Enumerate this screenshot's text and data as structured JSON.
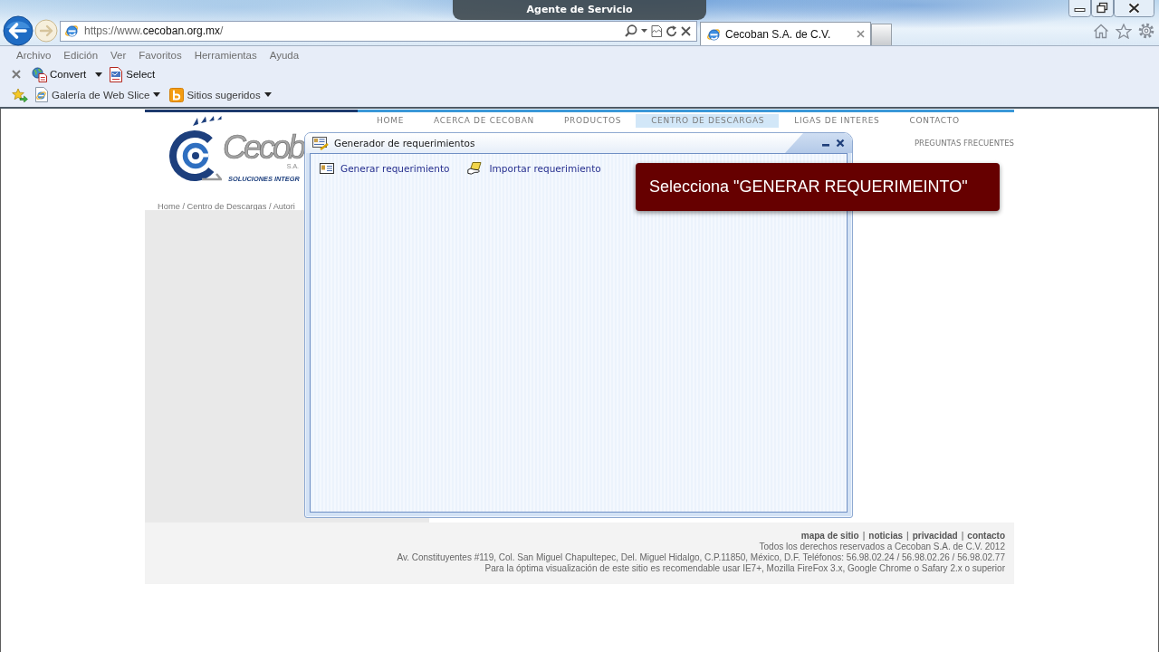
{
  "browser": {
    "notification": "Agente de Servicio",
    "address": {
      "value": "https://www.**cecoban.org.mx**/"
    },
    "tabs": [
      {
        "label": "Cecoban S.A. de C.V.",
        "selected": true
      }
    ],
    "menu": [
      "Archivo",
      "Edición",
      "Ver",
      "Favoritos",
      "Herramientas",
      "Ayuda"
    ],
    "command_bar": [
      {
        "label": "Convert",
        "dropdown": true
      },
      {
        "label": "Select",
        "dropdown": false
      }
    ],
    "favorites_bar": [
      {
        "label": "Galería de Web Slice",
        "dropdown": true
      },
      {
        "label": "Sitios sugeridos",
        "dropdown": true
      }
    ]
  },
  "site": {
    "logo": {
      "name": "Cecob",
      "suffix": "S.A.",
      "tagline": "SOLUCIONES INTEGR"
    },
    "nav": [
      {
        "label": "HOME",
        "selected": false
      },
      {
        "label": "ACERCA DE CECOBAN",
        "selected": false
      },
      {
        "label": "PRODUCTOS",
        "selected": false
      },
      {
        "label": "CENTRO DE DESCARGAS",
        "selected": true
      },
      {
        "label": "LIGAS DE INTERES",
        "selected": false
      },
      {
        "label": "CONTACTO",
        "selected": false
      }
    ],
    "faq_link": "PREGUNTAS FRECUENTES",
    "breadcrumb": "Home / Centro de Descargas / Autori",
    "footer": {
      "links": [
        {
          "kind": "link",
          "label": "mapa de sitio"
        },
        {
          "kind": "separator",
          "label": "|"
        },
        {
          "kind": "link",
          "label": "noticias"
        },
        {
          "kind": "separator",
          "label": "|"
        },
        {
          "kind": "link",
          "label": "privacidad"
        },
        {
          "kind": "separator",
          "label": "|"
        },
        {
          "kind": "link",
          "label": "contacto"
        }
      ],
      "lines": [
        "Todos los derechos reservados a Cecoban S.A. de C.V. 2012",
        "Av. Constituyentes #119, Col. San Miguel Chapultepec, Del. Miguel Hidalgo, C.P.11850, México, D.F. Teléfonos: 56.98.02.24 / 56.98.02.26 / 56.98.02.77",
        "Para la óptima visualización de este sitio es recomendable usar IE7+, Mozilla FireFox 3.x, Google Chrome o Safary 2.x o superior"
      ]
    }
  },
  "dialog": {
    "title": "Generador de requerimientos",
    "actions": [
      {
        "label": "Generar requerimiento"
      },
      {
        "label": "Importar requerimiento"
      }
    ]
  },
  "callout": "Selecciona \"GENERAR REQUERIMEINTO\""
}
